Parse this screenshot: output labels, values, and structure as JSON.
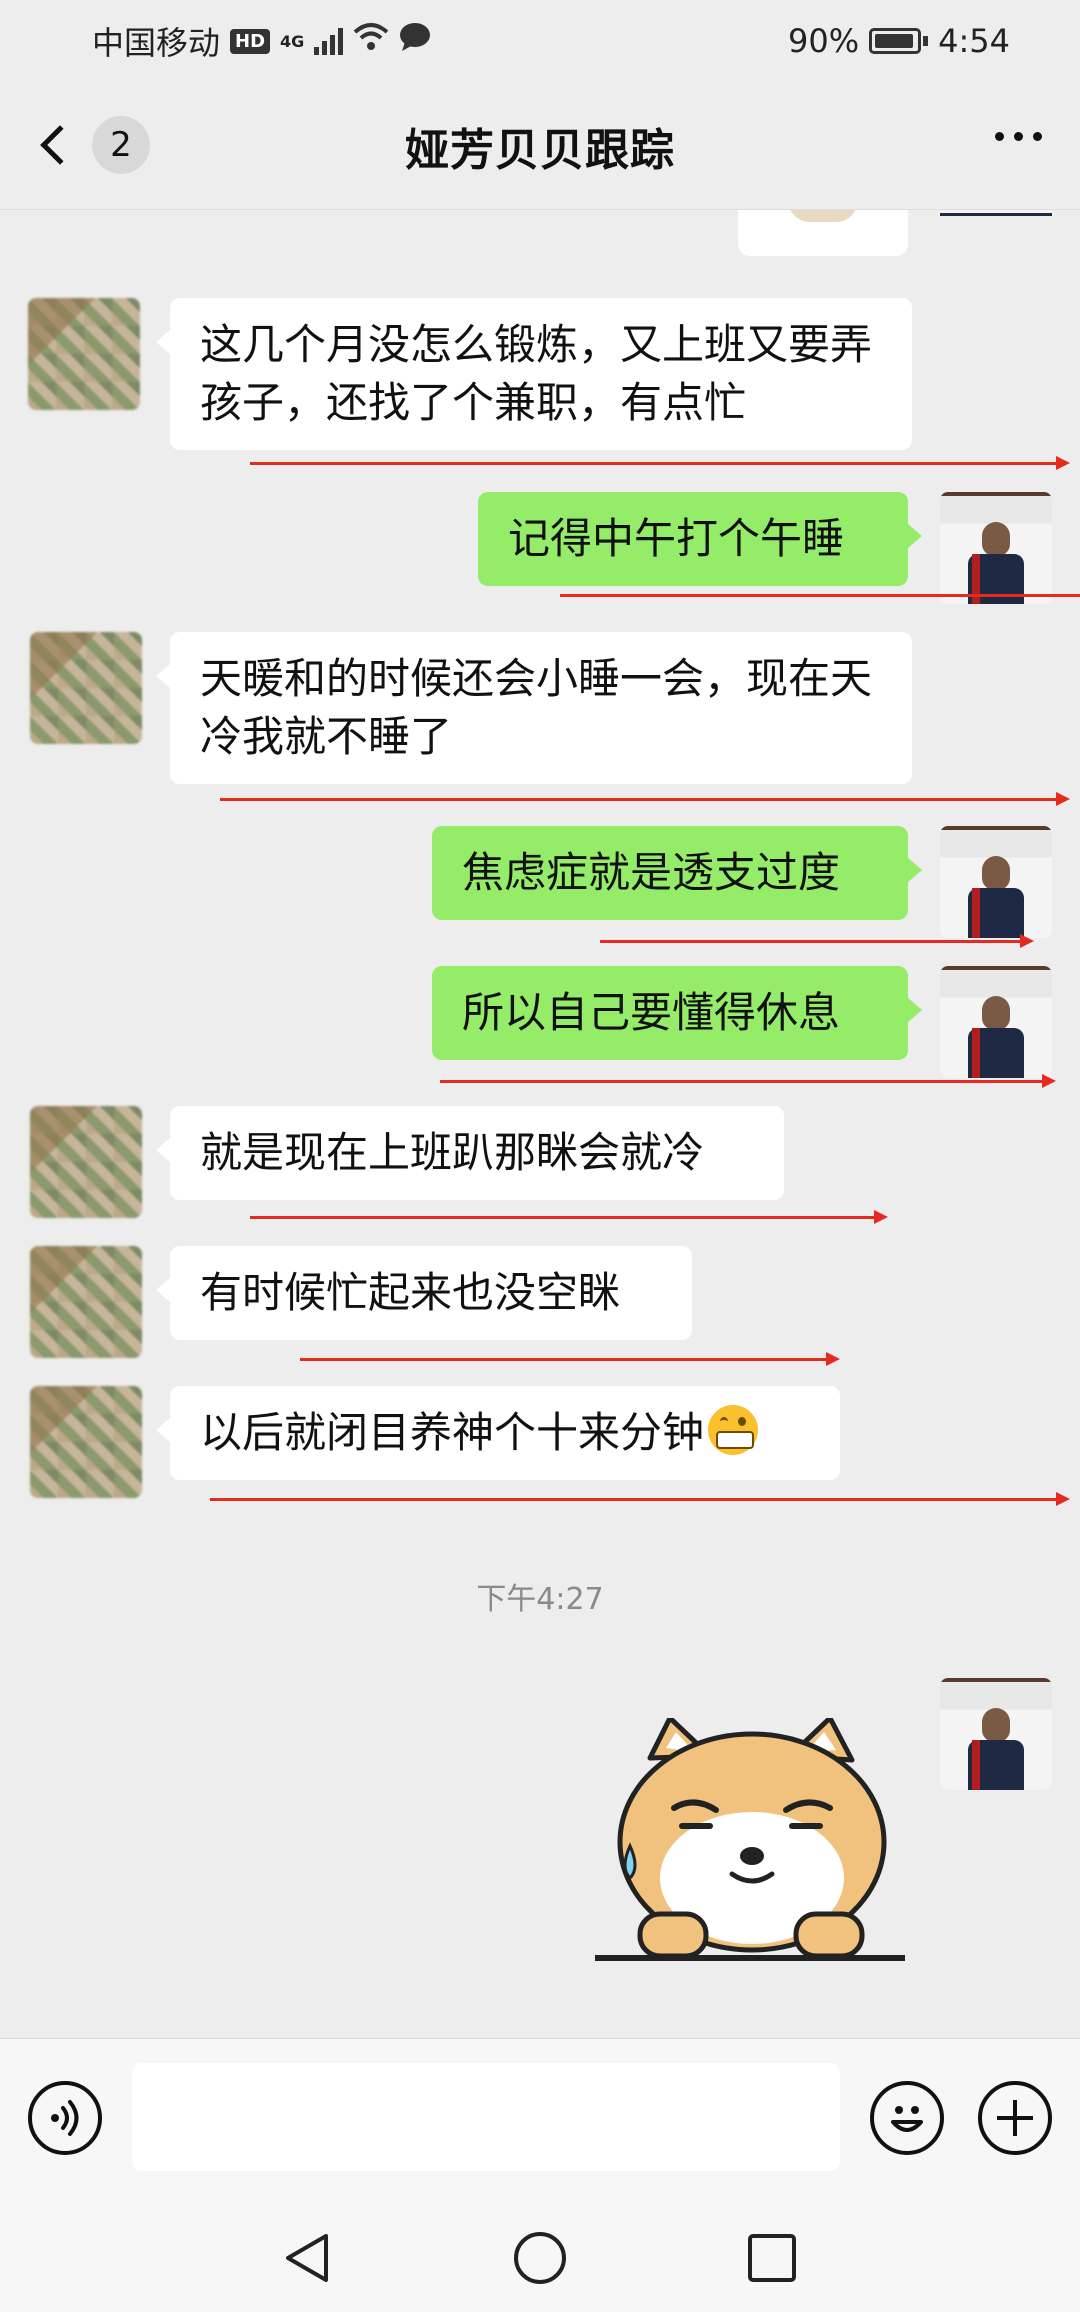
{
  "status_bar": {
    "carrier": "中国移动",
    "hd_badge": "HD",
    "net_type": "4G",
    "battery": "90%",
    "time": "4:54"
  },
  "header": {
    "unread_count": "2",
    "title": "娅芳贝贝跟踪"
  },
  "messages": [
    {
      "side": "in",
      "text": "这几个月没怎么锻炼，又上班又要弄孩子，还找了个兼职，有点忙"
    },
    {
      "side": "out",
      "text": "记得中午打个午睡"
    },
    {
      "side": "in",
      "text": "天暖和的时候还会小睡一会，现在天冷我就不睡了"
    },
    {
      "side": "out",
      "text": "焦虑症就是透支过度"
    },
    {
      "side": "out",
      "text": "所以自己要懂得休息"
    },
    {
      "side": "in",
      "text": "就是现在上班趴那眯会就冷"
    },
    {
      "side": "in",
      "text": "有时候忙起来也没空眯"
    },
    {
      "side": "in",
      "text": "以后就闭目养神个十来分钟"
    }
  ],
  "timestamp": "下午4:27",
  "icons": {
    "back": "chevron-left-icon",
    "more": "more-dots-icon",
    "voice": "voice-icon",
    "emoji": "emoji-icon",
    "plus": "plus-icon",
    "nav_back": "nav-back-icon",
    "nav_home": "nav-home-icon",
    "nav_recents": "nav-recents-icon"
  },
  "colors": {
    "outgoing_bubble": "#95ec69",
    "incoming_bubble": "#ffffff",
    "background": "#ededed",
    "annotation_line": "#e52a20"
  },
  "input": {
    "value": ""
  }
}
